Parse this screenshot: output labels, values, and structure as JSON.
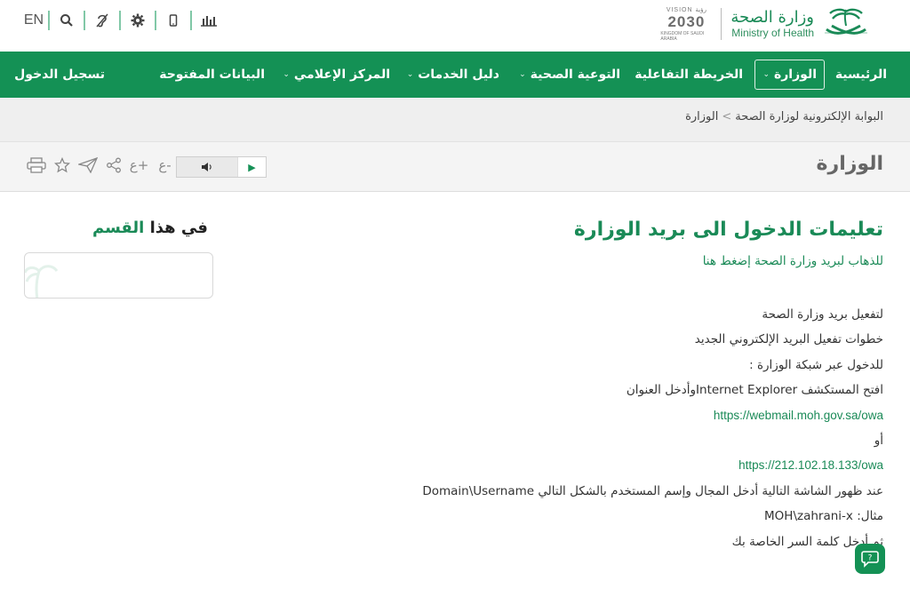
{
  "topbar": {
    "lang_label": "EN",
    "icons": [
      "search-icon",
      "hearing-icon",
      "gear-icon",
      "mobile-icon",
      "stats-icon"
    ]
  },
  "logo": {
    "ministry_ar": "وزارة الصحة",
    "ministry_en": "Ministry of Health",
    "vision_top": "VISION رؤية",
    "vision_year": "2030",
    "vision_bottom": "KINGDOM OF SAUDI ARABIA"
  },
  "nav": {
    "home": "الرئيسية",
    "ministry": "الوزارة",
    "map": "الخريطة التفاعلية",
    "awareness": "التوعية الصحية",
    "services": "دليل الخدمات",
    "media": "المركز الإعلامي",
    "open_data": "البيانات المفتوحة",
    "login": "تسجيل الدخول"
  },
  "breadcrumb": {
    "root": "البوابة الإلكترونية لوزارة الصحة",
    "separator": ">",
    "current": "الوزارة"
  },
  "page": {
    "title": "الوزارة"
  },
  "content": {
    "title": "تعليمات الدخول الى بريد الوزارة",
    "link": "للذهاب لبريد وزارة الصحة إضغط هنا",
    "lines": [
      "لتفعيل بريد وزارة الصحة",
      "خطوات تفعيل البريد الإلكتروني الجديد",
      "للدخول عبر شبكة الوزارة :",
      "افتح المستكشف Internet Explorerوأدخل العنوان",
      "https://webmail.moh.gov.sa/owa",
      "أو",
      "https://212.102.18.133/owa",
      "عند ظهور الشاشة التالية أدخل المجال وإسم المستخدم بالشكل التالي Domain\\Username",
      "مثال: MOH\\zahrani-x",
      "ثم أدخل كلمة السر الخاصة بك"
    ]
  },
  "sidebar": {
    "title_a": "في هذا",
    "title_b": "القسم"
  },
  "colors": {
    "brand_green": "#149155",
    "text_green": "#1a8a57"
  }
}
